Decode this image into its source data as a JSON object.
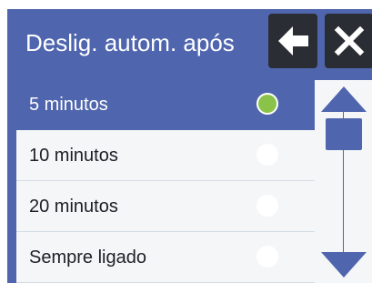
{
  "header": {
    "title": "Deslig. autom. após",
    "back_icon": "arrow-left-icon",
    "close_icon": "close-icon"
  },
  "list": {
    "items": [
      {
        "label": "5 minutos",
        "selected": true
      },
      {
        "label": "10 minutos",
        "selected": false
      },
      {
        "label": "20 minutos",
        "selected": false
      },
      {
        "label": "Sempre ligado",
        "selected": false
      }
    ]
  },
  "scrollbar": {
    "up_icon": "triangle-up-icon",
    "down_icon": "triangle-down-icon"
  },
  "colors": {
    "accent": "#4f65ad",
    "header_button": "#2a2d33",
    "selected_radio": "#8bc34a",
    "list_background": "#f4f6f8"
  }
}
